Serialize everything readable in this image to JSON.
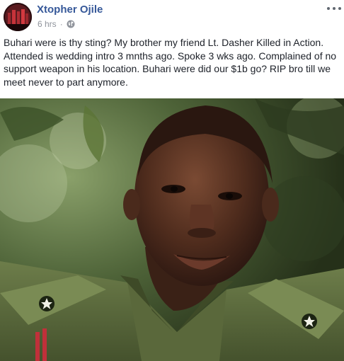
{
  "post": {
    "author": "Xtopher Ojile",
    "timestamp": "6 hrs",
    "separator": "·",
    "audience_icon": "globe-icon",
    "more_icon": "more-options-icon",
    "text": "Buhari were is thy sting? My brother my friend Lt. Dasher Killed in Action. Attended is wedding intro 3 mnths ago. Spoke 3 wks ago. Complained of no support weapon in his location. Buhari were did our $1b go? RIP bro till we meet never to part anymore.",
    "photo_subject": "portrait-photo"
  },
  "colors": {
    "author_link": "#365899",
    "meta_gray": "#90949c",
    "text": "#1d2129"
  }
}
